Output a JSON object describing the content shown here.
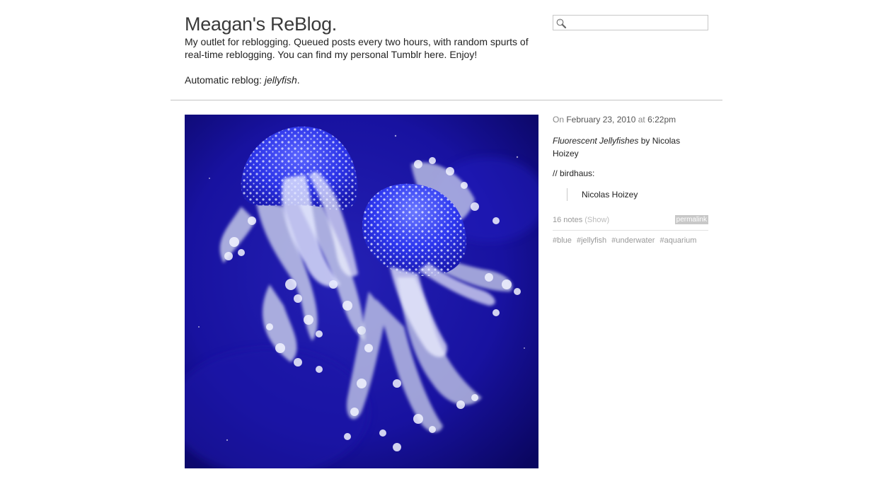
{
  "header": {
    "title": "Meagan's ReBlog.",
    "description_prefix": "My outlet for reblogging. Queued posts every two hours, with random spurts of real-time reblogging. You can find my personal Tumblr ",
    "description_link": "here",
    "description_suffix": ". Enjoy!",
    "auto_reblog_label": "Automatic reblog: ",
    "auto_reblog_tag": "jellyfish",
    "auto_reblog_end": "."
  },
  "search": {
    "value": "",
    "icon": "search-icon"
  },
  "post": {
    "date_prefix": "On ",
    "date": "February 23, 2010",
    "time_prefix": " at ",
    "time": "6:22pm",
    "caption_title": "Fluorescent Jellyfishes",
    "caption_by": " by Nicolas Hoizey",
    "via_prefix": "// ",
    "via_name": "birdhaus:",
    "quote": "Nicolas Hoizey",
    "notes": "16 notes",
    "notes_show": "(Show)",
    "permalink": "permalink",
    "tags": [
      "#blue",
      "#jellyfish",
      "#underwater",
      "#aquarium"
    ]
  },
  "colors": {
    "photo_background": "#14107a",
    "jellyfish_blue": "#2a2ae0",
    "divider": "#c4c4c4"
  }
}
